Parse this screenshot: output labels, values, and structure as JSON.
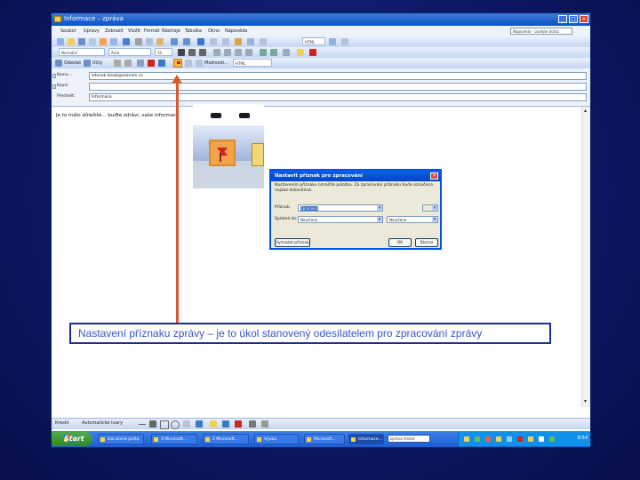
{
  "window": {
    "title": "Informace – zpráva",
    "controls": [
      "_",
      "□",
      "×"
    ]
  },
  "menu": {
    "items": [
      "Soubor",
      "Úpravy",
      "Zobrazit",
      "Vložit",
      "Formát",
      "Nástroje",
      "Tabulka",
      "Okno",
      "Nápověda"
    ],
    "help_box": "Nápověda – zadejte dotaz"
  },
  "toolbar1": {
    "style_select": "HTML"
  },
  "toolbar2": {
    "style_select": "Normální",
    "font_select": "Arial",
    "size_select": "10"
  },
  "toolbar3": {
    "send_label": "Odeslat",
    "options_label": "Možnosti...",
    "format_select": "HTML",
    "attach_label": "Účty"
  },
  "fields": {
    "to_label": "Komu...",
    "to_value": "zdenek.lesak@seznam.cz",
    "cc_label": "Kopie",
    "cc_value": "",
    "subject_label": "Předmět:",
    "subject_value": "Informace"
  },
  "body_text": "Je to málo důležité... buďte zdrávi, vaše informace",
  "drawbar": {
    "draw_label": "Kreslit",
    "autoshapes_label": "Automatické tvary"
  },
  "taskbar": {
    "start_label": "Start",
    "tasks": [
      "Doručená pošta",
      "3 Microsoft...",
      "2 Microsoft...",
      "Výuka",
      "Microsoft...",
      "Informace..."
    ],
    "search_placeholder": "zpráva hledat",
    "clock": "8:54"
  },
  "dialog": {
    "title": "Nastavit příznak pro zpracování",
    "description": "Nastavením příznaku označíte položku. Za zpracování příznaku bude označena nejako dokončená.",
    "flag_label": "Příznak:",
    "flag_value": "Zpracovat",
    "due_label": "Splatné do:",
    "due_value": "Neurčeno",
    "due_time_value": "Neurčeno",
    "clear_button": "Vymazat příznak",
    "ok_button": "OK",
    "cancel_button": "Storno"
  },
  "caption": "Nastavení příznaku zprávy – je to úkol stanovený odesílatelem pro zpracování zprávy",
  "colors": {
    "slide_background": "#0d1866",
    "caption_text": "#3a54c4",
    "arrow": "#d65a2a",
    "flag": "#d0231b"
  }
}
